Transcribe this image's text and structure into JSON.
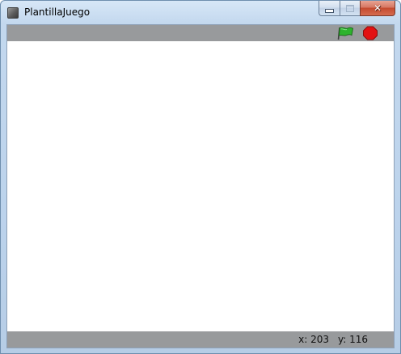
{
  "window": {
    "title": "PlantillaJuego",
    "icon": "app-icon",
    "controls": {
      "minimize": "minimize-icon",
      "maximize": "maximize-icon",
      "close": "close-icon"
    }
  },
  "toolbar": {
    "go_icon": "green-flag-icon",
    "stop_icon": "stop-sign-icon",
    "colors": {
      "background": "#989a9c",
      "flag": "#2db32d",
      "stop": "#e31212"
    }
  },
  "stage": {
    "background": "#ffffff"
  },
  "statusbar": {
    "x_label": "x:",
    "x_value": "203",
    "y_label": "y:",
    "y_value": "116"
  }
}
